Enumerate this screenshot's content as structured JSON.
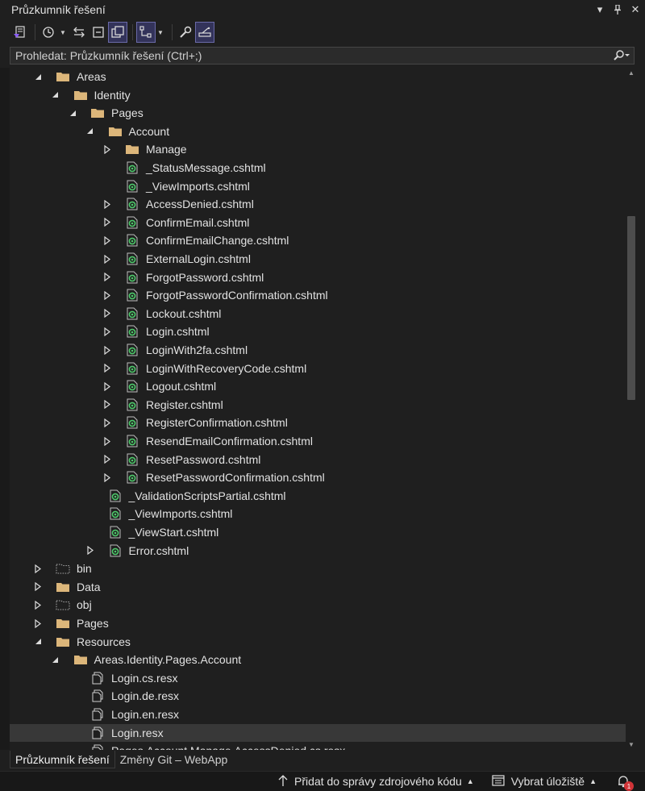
{
  "window": {
    "title": "Průzkumník řešení",
    "buttons": [
      {
        "name": "window-position-icon",
        "glyph": "▾"
      },
      {
        "name": "pin-icon",
        "glyph": "⊥"
      },
      {
        "name": "close-icon",
        "glyph": "✕"
      }
    ]
  },
  "search": {
    "placeholder": "Prohledat: Průzkumník řešení (Ctrl+;)"
  },
  "tree": [
    {
      "label": "Areas",
      "depth": 1,
      "icon": "folder",
      "expander": "expanded"
    },
    {
      "label": "Identity",
      "depth": 2,
      "icon": "folder",
      "expander": "expanded"
    },
    {
      "label": "Pages",
      "depth": 3,
      "icon": "folder",
      "expander": "expanded"
    },
    {
      "label": "Account",
      "depth": 4,
      "icon": "folder",
      "expander": "expanded"
    },
    {
      "label": "Manage",
      "depth": 5,
      "icon": "folder",
      "expander": "collapsed"
    },
    {
      "label": "_StatusMessage.cshtml",
      "depth": 5,
      "icon": "razor",
      "expander": "none"
    },
    {
      "label": "_ViewImports.cshtml",
      "depth": 5,
      "icon": "razor",
      "expander": "none"
    },
    {
      "label": "AccessDenied.cshtml",
      "depth": 5,
      "icon": "razor",
      "expander": "collapsed"
    },
    {
      "label": "ConfirmEmail.cshtml",
      "depth": 5,
      "icon": "razor",
      "expander": "collapsed"
    },
    {
      "label": "ConfirmEmailChange.cshtml",
      "depth": 5,
      "icon": "razor",
      "expander": "collapsed"
    },
    {
      "label": "ExternalLogin.cshtml",
      "depth": 5,
      "icon": "razor",
      "expander": "collapsed"
    },
    {
      "label": "ForgotPassword.cshtml",
      "depth": 5,
      "icon": "razor",
      "expander": "collapsed"
    },
    {
      "label": "ForgotPasswordConfirmation.cshtml",
      "depth": 5,
      "icon": "razor",
      "expander": "collapsed"
    },
    {
      "label": "Lockout.cshtml",
      "depth": 5,
      "icon": "razor",
      "expander": "collapsed"
    },
    {
      "label": "Login.cshtml",
      "depth": 5,
      "icon": "razor",
      "expander": "collapsed"
    },
    {
      "label": "LoginWith2fa.cshtml",
      "depth": 5,
      "icon": "razor",
      "expander": "collapsed"
    },
    {
      "label": "LoginWithRecoveryCode.cshtml",
      "depth": 5,
      "icon": "razor",
      "expander": "collapsed"
    },
    {
      "label": "Logout.cshtml",
      "depth": 5,
      "icon": "razor",
      "expander": "collapsed"
    },
    {
      "label": "Register.cshtml",
      "depth": 5,
      "icon": "razor",
      "expander": "collapsed"
    },
    {
      "label": "RegisterConfirmation.cshtml",
      "depth": 5,
      "icon": "razor",
      "expander": "collapsed"
    },
    {
      "label": "ResendEmailConfirmation.cshtml",
      "depth": 5,
      "icon": "razor",
      "expander": "collapsed"
    },
    {
      "label": "ResetPassword.cshtml",
      "depth": 5,
      "icon": "razor",
      "expander": "collapsed"
    },
    {
      "label": "ResetPasswordConfirmation.cshtml",
      "depth": 5,
      "icon": "razor",
      "expander": "collapsed"
    },
    {
      "label": "_ValidationScriptsPartial.cshtml",
      "depth": 4,
      "icon": "razor",
      "expander": "none"
    },
    {
      "label": "_ViewImports.cshtml",
      "depth": 4,
      "icon": "razor",
      "expander": "none"
    },
    {
      "label": "_ViewStart.cshtml",
      "depth": 4,
      "icon": "razor",
      "expander": "none"
    },
    {
      "label": "Error.cshtml",
      "depth": 4,
      "icon": "razor",
      "expander": "collapsed"
    },
    {
      "label": "bin",
      "depth": 1,
      "icon": "folder-excluded",
      "expander": "collapsed"
    },
    {
      "label": "Data",
      "depth": 1,
      "icon": "folder",
      "expander": "collapsed"
    },
    {
      "label": "obj",
      "depth": 1,
      "icon": "folder-excluded",
      "expander": "collapsed"
    },
    {
      "label": "Pages",
      "depth": 1,
      "icon": "folder",
      "expander": "collapsed"
    },
    {
      "label": "Resources",
      "depth": 1,
      "icon": "folder",
      "expander": "expanded"
    },
    {
      "label": "Areas.Identity.Pages.Account",
      "depth": 2,
      "icon": "folder",
      "expander": "expanded"
    },
    {
      "label": "Login.cs.resx",
      "depth": 3,
      "icon": "resx",
      "expander": "none"
    },
    {
      "label": "Login.de.resx",
      "depth": 3,
      "icon": "resx",
      "expander": "none"
    },
    {
      "label": "Login.en.resx",
      "depth": 3,
      "icon": "resx",
      "expander": "none"
    },
    {
      "label": "Login.resx",
      "depth": 3,
      "icon": "resx",
      "expander": "none",
      "selected": true
    },
    {
      "label": "Pages.Account.Manage.AccessDenied.cs.resx",
      "depth": 3,
      "icon": "resx",
      "expander": "none"
    }
  ],
  "tabs": [
    {
      "label": "Průzkumník řešení",
      "active": true
    },
    {
      "label": "Změny Git – WebApp",
      "active": false
    }
  ],
  "statusbar": {
    "add_to_source_control": "Přidat do správy zdrojového kódu",
    "select_repository": "Vybrat úložiště",
    "notifications_count": "1"
  },
  "colors": {
    "background": "#1f1f1f",
    "folder": "#dcb67a",
    "razor": "#4ec96b",
    "selection": "#383838",
    "badge": "#d13438"
  }
}
